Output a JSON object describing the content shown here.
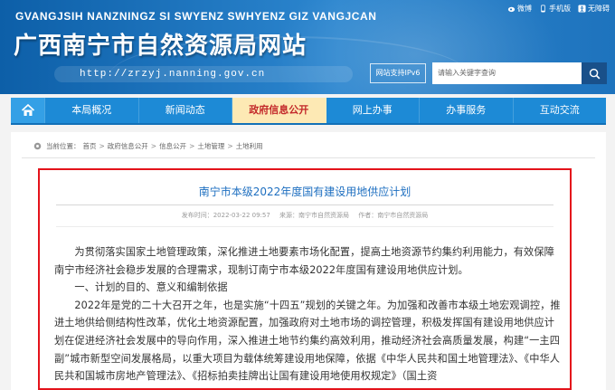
{
  "header": {
    "site_name_en": "GVANGJSIH NANZNINGZ SI SWYENZ SWHYENZ GIZ VANGJCAN",
    "site_name_cn": "广西南宁市自然资源局网站",
    "url": "http://zrzyj.nanning.gov.cn",
    "ipv6_label": "网站支持IPv6",
    "search_placeholder": "请输入关键字查询",
    "top_links": [
      {
        "label": "微博",
        "icon": "weibo-icon"
      },
      {
        "label": "手机版",
        "icon": "mobile-icon"
      },
      {
        "label": "无障碍",
        "icon": "accessibility-icon"
      }
    ]
  },
  "nav": {
    "items": [
      "本局概况",
      "新闻动态",
      "政府信息公开",
      "网上办事",
      "办事服务",
      "互动交流"
    ],
    "active_index": 2
  },
  "breadcrumb": {
    "label": "当前位置：",
    "items": [
      "首页",
      "政府信息公开",
      "信息公开",
      "土地管理",
      "土地利用"
    ]
  },
  "article": {
    "title": "南宁市本级2022年度国有建设用地供应计划",
    "publish_time": "发布时间：2022-03-22 09:57",
    "source": "来源：南宁市自然资源局",
    "author": "作者：南宁市自然资源局",
    "p1": "为贯彻落实国家土地管理政策，深化推进土地要素市场化配置，提高土地资源节约集约利用能力，有效保障南宁市经济社会稳步发展的合理需求，现制订南宁市本级2022年度国有建设用地供应计划。",
    "h1": "一、计划的目的、意义和编制依据",
    "p2": "2022年是党的二十大召开之年，也是实施“十四五”规划的关键之年。为加强和改善市本级土地宏观调控，推进土地供给侧结构性改革，优化土地资源配置，加强政府对土地市场的调控管理，积极发挥国有建设用地供应计划在促进经济社会发展中的导向作用，深入推进土地节约集约高效利用，推动经济社会高质量发展，构建“一主四副”城市新型空间发展格局，以重大项目为载体统筹建设用地保障，依据《中华人民共和国土地管理法》、《中华人民共和国城市房地产管理法》、《招标拍卖挂牌出让国有建设用地使用权规定》（国土资"
  },
  "colors": {
    "header_blue": "#1e73bd",
    "nav_blue": "#1d8ad6",
    "nav_active_bg": "#fde9b4",
    "nav_active_text": "#c3282a",
    "title_blue": "#1e6fc0",
    "highlight_red": "#e4131b"
  }
}
